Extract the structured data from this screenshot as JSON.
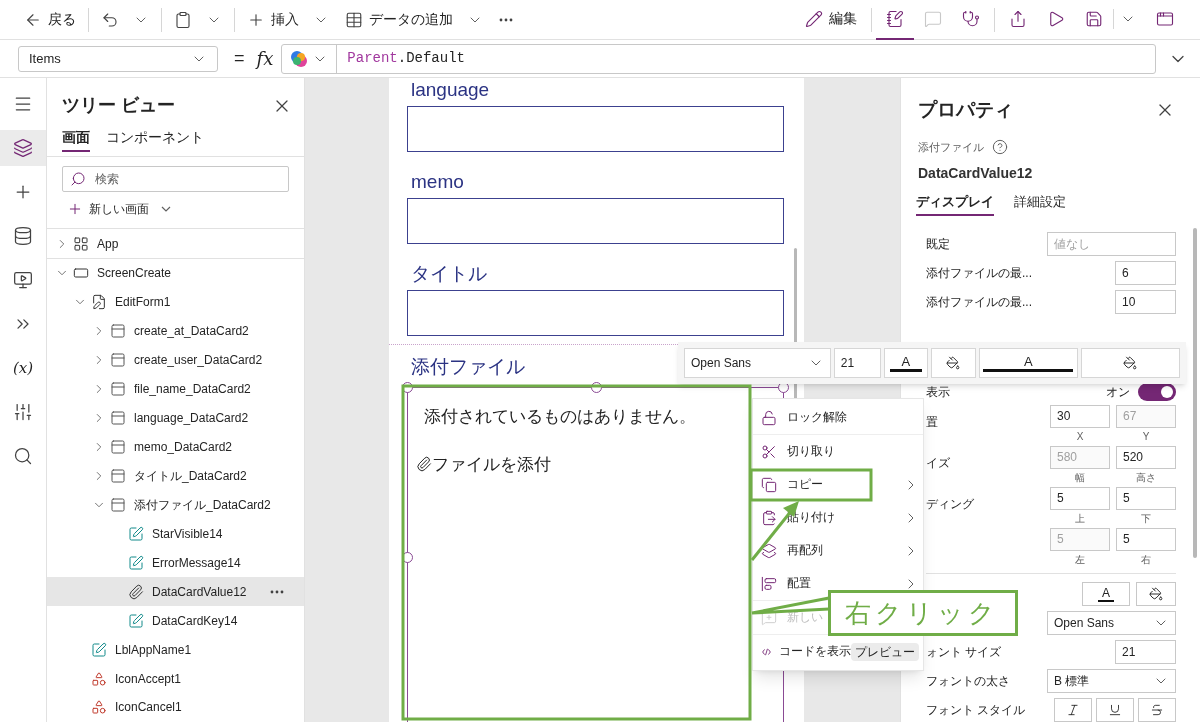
{
  "command_bar": {
    "left": [
      {
        "kind": "back",
        "label": "戻る"
      },
      {
        "kind": "undo"
      },
      {
        "kind": "paste"
      },
      {
        "kind": "insert",
        "label": "挿入"
      },
      {
        "kind": "data",
        "label": "データの追加"
      },
      {
        "kind": "more"
      }
    ],
    "right": [
      {
        "kind": "edit",
        "label": "編集",
        "active": false,
        "disabled": false
      },
      {
        "kind": "notes",
        "active": true,
        "disabled": false
      },
      {
        "kind": "comments",
        "active": false,
        "disabled": true
      },
      {
        "kind": "checker",
        "active": false,
        "disabled": false
      },
      {
        "kind": "share",
        "active": false,
        "disabled": false
      },
      {
        "kind": "play",
        "active": false,
        "disabled": false
      },
      {
        "kind": "save",
        "active": false,
        "disabled": false
      },
      {
        "kind": "publish",
        "active": false,
        "disabled": false
      }
    ]
  },
  "formula_bar": {
    "property": "Items",
    "operator": "=",
    "fx": "fx",
    "formula": [
      {
        "text": "Parent",
        "kind": "keyword"
      },
      {
        "text": ".Default",
        "kind": "plain"
      }
    ]
  },
  "left_rail": [
    {
      "kind": "menu",
      "selected": false
    },
    {
      "kind": "layers",
      "selected": true
    },
    {
      "kind": "insert",
      "selected": false
    },
    {
      "kind": "data",
      "selected": false
    },
    {
      "kind": "media",
      "selected": false
    },
    {
      "kind": "flows",
      "selected": false
    },
    {
      "kind": "variables",
      "label": "(x)",
      "selected": false
    },
    {
      "kind": "tools",
      "selected": false
    },
    {
      "kind": "search",
      "selected": false
    }
  ],
  "tree_view": {
    "title": "ツリー ビュー",
    "tabs": [
      {
        "label": "画面",
        "selected": true
      },
      {
        "label": "コンポーネント",
        "selected": false
      }
    ],
    "search": {
      "placeholder": "検索"
    },
    "new_screen": "新しい画面",
    "items": [
      {
        "name": "App",
        "kind": "app",
        "expanded": false,
        "selected": false
      },
      {
        "name": "ScreenCreate",
        "kind": "screen",
        "expanded": true,
        "selected": false,
        "children": [
          {
            "name": "EditForm1",
            "kind": "form",
            "expanded": true,
            "selected": false,
            "children": [
              {
                "name": "create_at_DataCard2",
                "kind": "card",
                "expanded": false,
                "selected": false
              },
              {
                "name": "create_user_DataCard2",
                "kind": "card",
                "expanded": false,
                "selected": false
              },
              {
                "name": "file_name_DataCard2",
                "kind": "card",
                "expanded": false,
                "selected": false
              },
              {
                "name": "language_DataCard2",
                "kind": "card",
                "expanded": false,
                "selected": false
              },
              {
                "name": "memo_DataCard2",
                "kind": "card",
                "expanded": false,
                "selected": false
              },
              {
                "name": "タイトル_DataCard2",
                "kind": "card",
                "expanded": false,
                "selected": false
              },
              {
                "name": "添付ファイル_DataCard2",
                "kind": "card",
                "expanded": true,
                "selected": false,
                "children": [
                  {
                    "name": "StarVisible14",
                    "kind": "label",
                    "selected": false
                  },
                  {
                    "name": "ErrorMessage14",
                    "kind": "label",
                    "selected": false
                  },
                  {
                    "name": "DataCardValue12",
                    "kind": "attachment",
                    "selected": true
                  },
                  {
                    "name": "DataCardKey14",
                    "kind": "label",
                    "selected": false
                  }
                ]
              }
            ]
          },
          {
            "name": "LblAppName1",
            "kind": "label",
            "selected": false
          },
          {
            "name": "IconAccept1",
            "kind": "icon",
            "selected": false
          },
          {
            "name": "IconCancel1",
            "kind": "icon",
            "selected": false
          }
        ]
      }
    ]
  },
  "canvas": {
    "fields": [
      {
        "label": "language"
      },
      {
        "label": "memo"
      },
      {
        "label": "タイトル"
      }
    ],
    "attachments": {
      "label": "添付ファイル",
      "empty_text": "添付されているものはありません。",
      "add_text": "ファイルを添付"
    }
  },
  "properties": {
    "title": "プロパティ",
    "control_type": "添付ファイル",
    "control_name": "DataCardValue12",
    "tabs": [
      {
        "label": "ディスプレイ",
        "selected": true
      },
      {
        "label": "詳細設定",
        "selected": false
      }
    ],
    "rows": [
      {
        "kind": "text",
        "label": "既定",
        "placeholder": "値なし"
      },
      {
        "kind": "number",
        "label": "添付ファイルの最...",
        "value": "6"
      },
      {
        "kind": "number",
        "label": "添付ファイルの最...",
        "value": "10"
      },
      {
        "kind": "toggle",
        "label": "表示",
        "state_label": "オン",
        "on": true
      },
      {
        "kind": "pair",
        "label": "置",
        "fields": [
          {
            "value": "30",
            "caption": "X",
            "disabled": false
          },
          {
            "value": "67",
            "caption": "Y",
            "disabled": true
          }
        ]
      },
      {
        "kind": "pair",
        "label": "イズ",
        "fields": [
          {
            "value": "580",
            "caption": "幅",
            "disabled": true
          },
          {
            "value": "520",
            "caption": "高さ",
            "disabled": false
          }
        ]
      },
      {
        "kind": "pair",
        "label": "ディング",
        "fields": [
          {
            "value": "5",
            "caption": "上",
            "disabled": false
          },
          {
            "value": "5",
            "caption": "下",
            "disabled": false
          }
        ]
      },
      {
        "kind": "pair",
        "fields": [
          {
            "value": "5",
            "caption": "左",
            "disabled": true
          },
          {
            "value": "5",
            "caption": "右",
            "disabled": false
          }
        ]
      },
      {
        "kind": "colors",
        "font_color_label": "A"
      },
      {
        "kind": "select",
        "value": "Open Sans"
      },
      {
        "kind": "number",
        "label": "ォント サイズ",
        "value": "21"
      },
      {
        "kind": "select",
        "label": "フォントの太さ",
        "value": "B 標準"
      },
      {
        "kind": "styles",
        "label": "フォント スタイル"
      }
    ]
  },
  "text_toolbar": {
    "font": "Open Sans",
    "size": "21",
    "buttons": [
      {
        "kind": "font_color",
        "label": "A"
      },
      {
        "kind": "fill"
      },
      {
        "kind": "border_color",
        "label": "A"
      },
      {
        "kind": "border_fill"
      }
    ]
  },
  "context_menu": [
    {
      "kind": "unlock",
      "label": "ロック解除",
      "submenu": false,
      "disabled": false
    },
    {
      "kind": "cut",
      "label": "切り取り",
      "submenu": false,
      "disabled": false
    },
    {
      "kind": "copy",
      "label": "コピー",
      "submenu": true,
      "disabled": false
    },
    {
      "kind": "paste",
      "label": "貼り付け",
      "submenu": true,
      "disabled": false
    },
    {
      "kind": "reorder",
      "label": "再配列",
      "submenu": true,
      "disabled": false
    },
    {
      "kind": "align",
      "label": "配置",
      "submenu": true,
      "disabled": false
    },
    {
      "kind": "comment",
      "label": "新しい",
      "submenu": false,
      "disabled": true
    },
    {
      "kind": "code",
      "label": "コードを表示",
      "badge": "プレビュー",
      "submenu": false,
      "disabled": false
    }
  ],
  "annotation": {
    "callout": "右クリック"
  }
}
